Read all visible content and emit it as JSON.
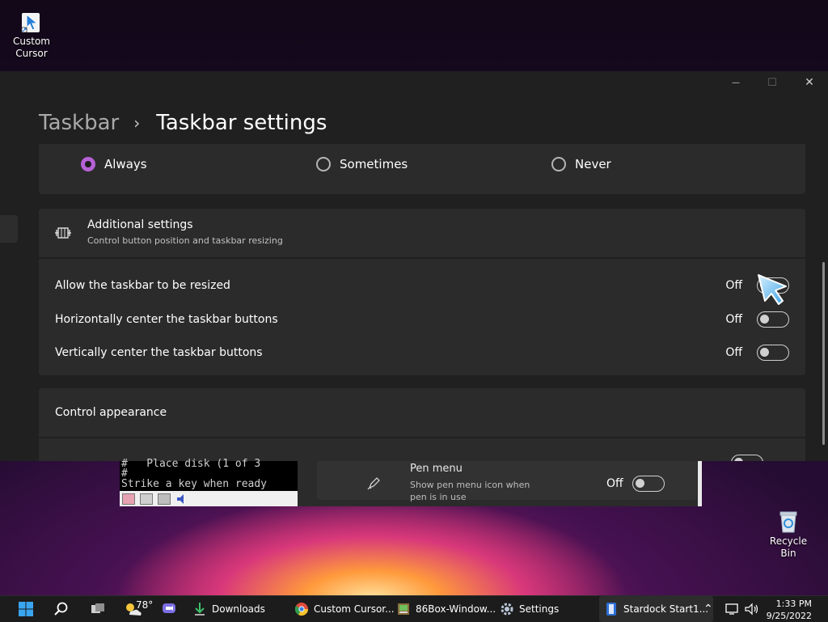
{
  "desktop": {
    "custom_cursor_label": "Custom Cursor",
    "recycle_bin_label": "Recycle Bin"
  },
  "settings_window": {
    "breadcrumb": {
      "parent": "Taskbar",
      "separator": "›",
      "current": "Taskbar settings"
    },
    "window_controls": {
      "minimize": "—",
      "maximize": "☐",
      "close": "✕"
    },
    "radio_group": {
      "options": [
        {
          "label": "Always",
          "selected": true
        },
        {
          "label": "Sometimes",
          "selected": false
        },
        {
          "label": "Never",
          "selected": false
        }
      ]
    },
    "additional_settings": {
      "title": "Additional settings",
      "subtitle": "Control button position and taskbar resizing",
      "rows": [
        {
          "label": "Allow the taskbar to be resized",
          "state": "Off"
        },
        {
          "label": "Horizontally center the taskbar buttons",
          "state": "Off"
        },
        {
          "label": "Vertically center the taskbar buttons",
          "state": "Off"
        }
      ]
    },
    "control_appearance": {
      "title": "Control appearance"
    }
  },
  "box86_console": {
    "line1": "#   Place disk (1 of 3",
    "line2": "#",
    "line3": "Strike a key when ready"
  },
  "pen_menu": {
    "title": "Pen menu",
    "subtitle": "Show pen menu icon when pen is in use",
    "state": "Off"
  },
  "taskbar": {
    "weather_temp": "78°",
    "items": [
      {
        "label": "Downloads"
      },
      {
        "label": "Custom Cursor..."
      },
      {
        "label": "86Box-Window..."
      },
      {
        "label": "Settings"
      },
      {
        "label": "Stardock Start1..."
      }
    ],
    "clock_time": "1:33 PM",
    "clock_date": "9/25/2022"
  },
  "colors": {
    "accent": "#b661d6",
    "window_bg": "#202020",
    "card_bg": "#2b2b2b",
    "taskbar_bg": "#1c1c1c"
  }
}
